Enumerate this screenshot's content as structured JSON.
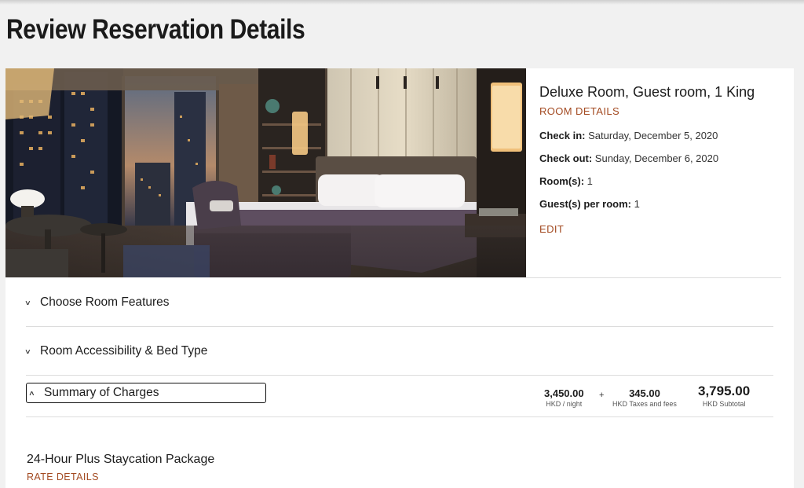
{
  "page": {
    "title": "Review Reservation Details"
  },
  "room": {
    "name": "Deluxe Room, Guest room, 1 King",
    "details_link": "ROOM DETAILS",
    "check_in_label": "Check in:",
    "check_in_value": "Saturday, December 5, 2020",
    "check_out_label": "Check out:",
    "check_out_value": "Sunday, December 6, 2020",
    "rooms_label": "Room(s):",
    "rooms_value": "1",
    "guests_label": "Guest(s) per room:",
    "guests_value": "1",
    "edit_link": "EDIT"
  },
  "sections": {
    "room_features": "Choose Room Features",
    "accessibility": "Room Accessibility & Bed Type",
    "summary": "Summary of Charges"
  },
  "charges": {
    "nightly_amount": "3,450.00",
    "nightly_label": "HKD / night",
    "plus": "+",
    "taxes_amount": "345.00",
    "taxes_label": "HKD Taxes and fees",
    "subtotal_amount": "3,795.00",
    "subtotal_label": "HKD Subtotal"
  },
  "package": {
    "title": "24-Hour Plus Staycation Package",
    "rate_link": "RATE DETAILS"
  },
  "colors": {
    "accent": "#a34a21",
    "background": "#f1f1f1",
    "card": "#ffffff"
  },
  "icons": {
    "collapsed": "chevron-down-icon",
    "expanded": "chevron-up-icon"
  }
}
